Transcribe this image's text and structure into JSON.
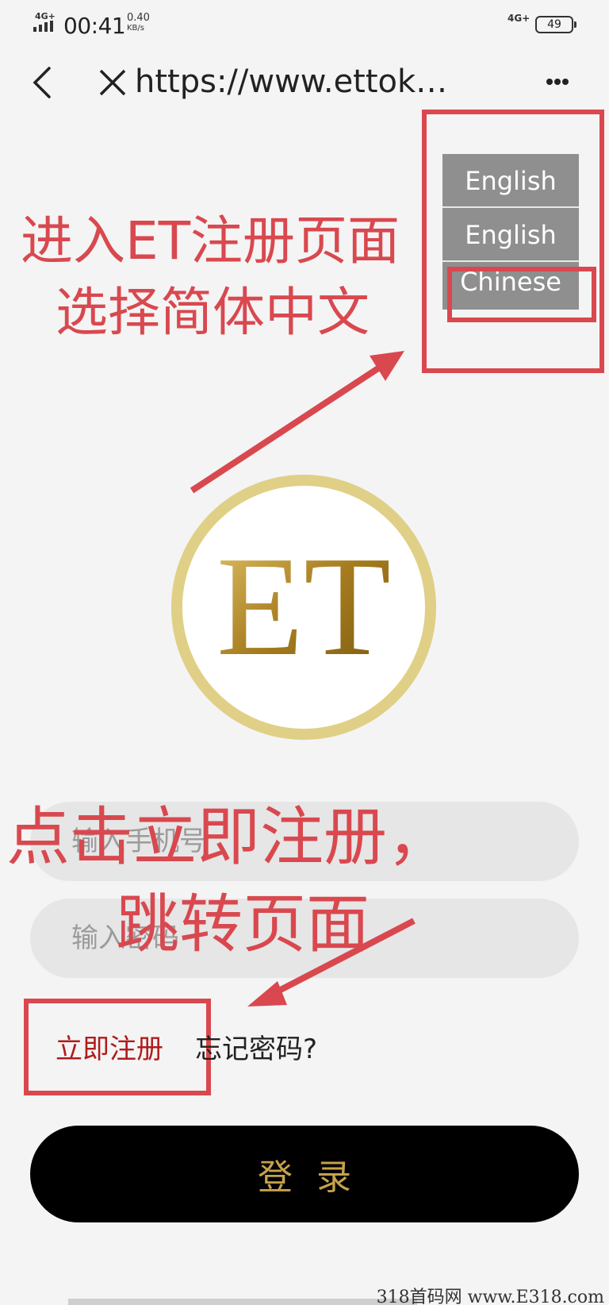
{
  "status_bar": {
    "network": "4G+",
    "time": "00:41",
    "speed_value": "0.40",
    "speed_unit": "KB/s",
    "network_right": "4G+",
    "battery": "49"
  },
  "nav": {
    "url": "https://www.ettok…",
    "icons": [
      "back-icon",
      "close-icon",
      "more-icon"
    ]
  },
  "language_menu": {
    "options": [
      "English",
      "English",
      "Chinese"
    ]
  },
  "annotations": {
    "top_line1": "进入ET注册页面",
    "top_line2": "选择简体中文",
    "mid_line1": "点击立即注册，",
    "mid_line2": "跳转页面",
    "color": "#d9484f"
  },
  "logo": {
    "text": "ET",
    "ring_color": "#e0cf86",
    "letter_color": "#b18a2b"
  },
  "form": {
    "phone_placeholder": "输入手机号",
    "password_placeholder": "输入密码",
    "register_label": "立即注册",
    "forgot_label": "忘记密码?",
    "login_label": "登录"
  },
  "watermark": "318首码网 www.E318.com"
}
